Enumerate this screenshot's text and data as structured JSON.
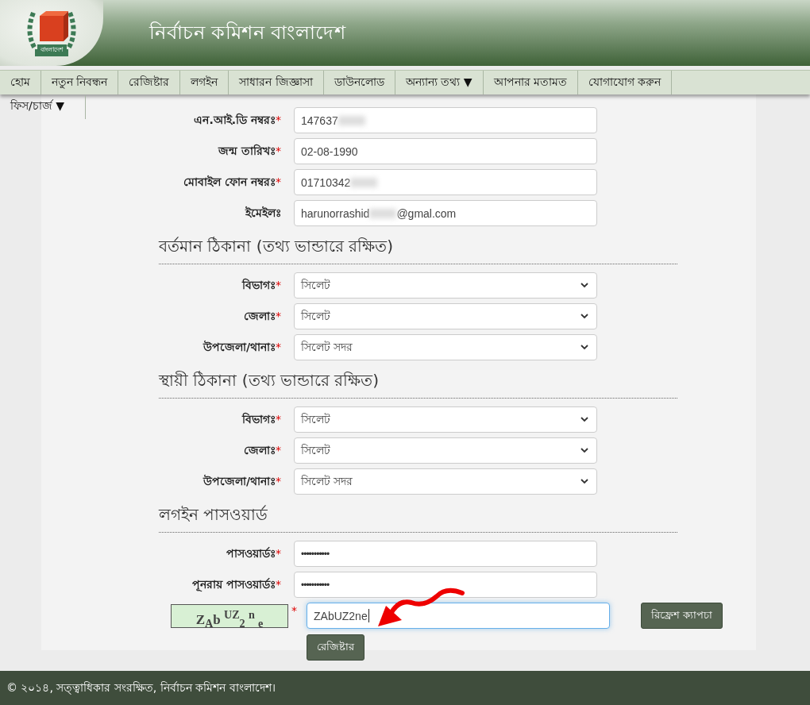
{
  "header": {
    "title": "নির্বাচন কমিশন  বাংলাদেশ",
    "logo_text": "বাংলাদেশ"
  },
  "nav": {
    "items": [
      {
        "label": "হোম"
      },
      {
        "label": "নতুন নিবন্ধন"
      },
      {
        "label": "রেজিষ্টার"
      },
      {
        "label": "লগইন"
      },
      {
        "label": "সাধারন জিজ্ঞাসা"
      },
      {
        "label": "ডাউনলোড"
      },
      {
        "label": "অন্যান্য তথ্য ▼"
      },
      {
        "label": "আপনার মতামত"
      },
      {
        "label": "যোগাযোগ করুন"
      }
    ],
    "overflow_item": {
      "label": "ফিস/চার্জ ▼"
    }
  },
  "personal_fields": [
    {
      "label": "এন.আই.ডি নম্বরঃ",
      "required": true,
      "kind": "text",
      "value": "147637",
      "redacted": true
    },
    {
      "label": "জন্ম তারিখঃ",
      "required": true,
      "kind": "text",
      "value": "02-08-1990",
      "redacted": false
    },
    {
      "label": "মোবাইল ফোন নম্বরঃ",
      "required": true,
      "kind": "text",
      "value": "01710342",
      "redacted": true
    },
    {
      "label": "ইমেইলঃ",
      "required": false,
      "kind": "text",
      "value": "harunorrashid",
      "redacted": true,
      "value_after": "@gmal.com"
    }
  ],
  "sections": [
    {
      "heading": "বর্তমান ঠিকানা (তথ্য ভান্ডারে রক্ষিত)",
      "fields": [
        {
          "label": "বিভাগঃ",
          "required": true,
          "kind": "select",
          "value": "সিলেট"
        },
        {
          "label": "জেলাঃ",
          "required": true,
          "kind": "select",
          "value": "সিলেট"
        },
        {
          "label": "উপজেলা/থানাঃ",
          "required": true,
          "kind": "select",
          "value": "সিলেট সদর"
        }
      ]
    },
    {
      "heading": "স্থায়ী ঠিকানা (তথ্য ভান্ডারে রক্ষিত)",
      "fields": [
        {
          "label": "বিভাগঃ",
          "required": true,
          "kind": "select",
          "value": "সিলেট"
        },
        {
          "label": "জেলাঃ",
          "required": true,
          "kind": "select",
          "value": "সিলেট"
        },
        {
          "label": "উপজেলা/থানাঃ",
          "required": true,
          "kind": "select",
          "value": "সিলেট সদর"
        }
      ]
    },
    {
      "heading": "লগইন পাসওয়ার্ড",
      "fields": [
        {
          "label": "পাসওয়ার্ডঃ",
          "required": true,
          "kind": "password",
          "value": "•••••••••••"
        },
        {
          "label": "পূনরায় পাসওয়ার্ডঃ",
          "required": true,
          "kind": "password",
          "value": "•••••••••••"
        }
      ]
    }
  ],
  "captcha": {
    "text": "Z$_{A}$b $^{UZ}$$_{2}$ $^{n}$ $_{e}$",
    "required": true,
    "value": "ZAbUZ2ne",
    "focused": true,
    "refresh_button": "রিফ্রেশ ক্যাপচা"
  },
  "submit_button": "রেজিষ্টার",
  "required_mark": "*",
  "footer": "© ২০১৪, সত্ত্বাধিকার সংরক্ষিত, নির্বাচন কমিশন বাংলাদেশ।"
}
